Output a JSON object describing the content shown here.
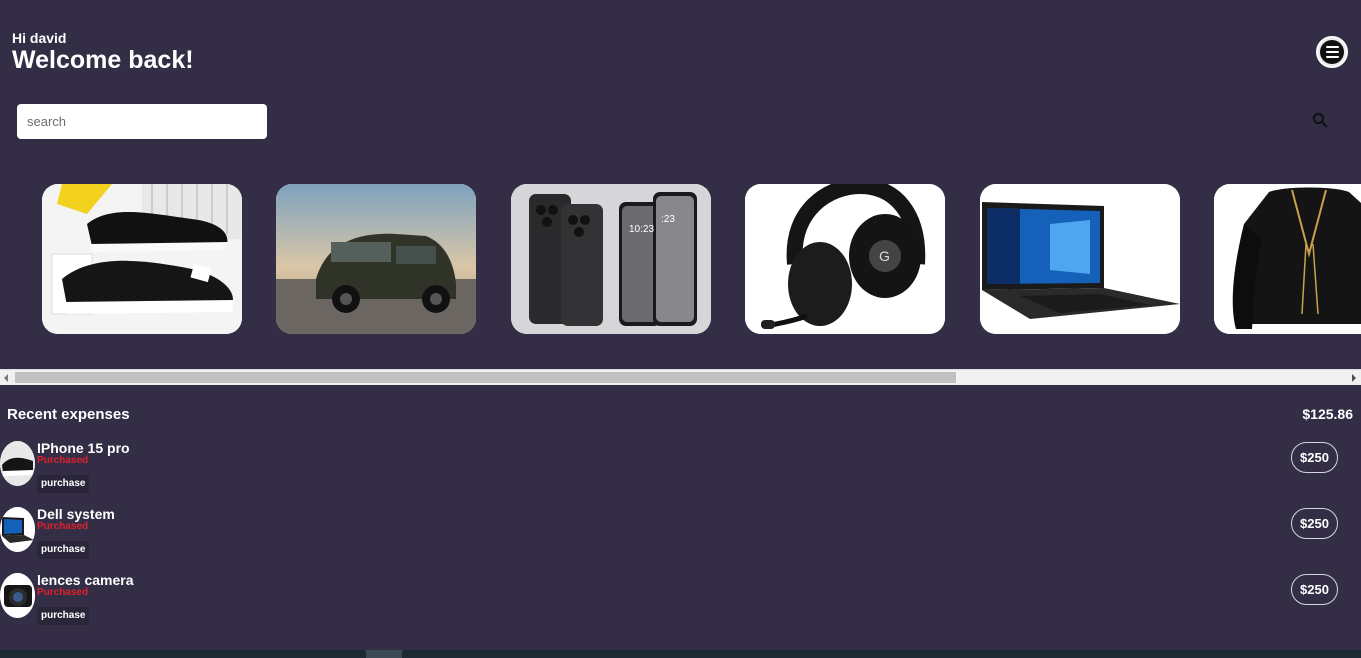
{
  "header": {
    "greeting": "Hi david",
    "welcome": "Welcome back!"
  },
  "menu": {
    "icon": "hamburger-menu-icon"
  },
  "search": {
    "placeholder": "search",
    "value": "",
    "icon": "search-icon"
  },
  "carousel": {
    "items": [
      {
        "name": "sneakers",
        "icon": "sneakers-image"
      },
      {
        "name": "suv",
        "icon": "car-image"
      },
      {
        "name": "iphones",
        "icon": "phone-image"
      },
      {
        "name": "headset",
        "icon": "headset-image"
      },
      {
        "name": "laptop",
        "icon": "laptop-image"
      },
      {
        "name": "blouse",
        "icon": "blouse-image"
      }
    ],
    "scroll_position": 0
  },
  "recent": {
    "title": "Recent expenses",
    "total": "$125.86",
    "items": [
      {
        "name": "IPhone 15 pro",
        "status": "Purchased",
        "tag": "purchase",
        "amount": "$250"
      },
      {
        "name": "Dell system",
        "status": "Purchased",
        "tag": "purchase",
        "amount": "$250"
      },
      {
        "name": "lences camera",
        "status": "Purchased",
        "tag": "purchase",
        "amount": "$250"
      }
    ]
  },
  "colors": {
    "background": "#332d45",
    "status_red": "#e0202a",
    "card_bg": "#ffffff"
  }
}
